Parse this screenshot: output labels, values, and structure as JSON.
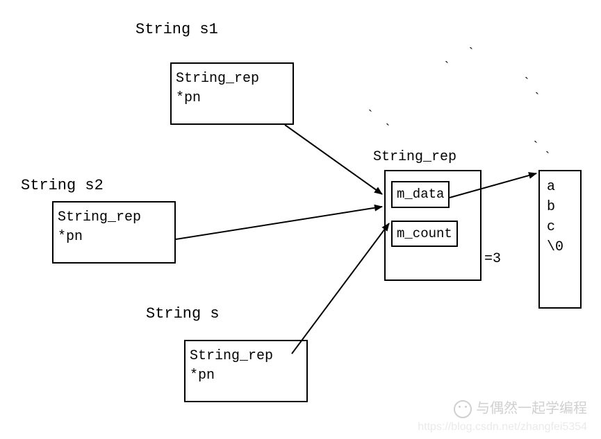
{
  "labels": {
    "s1": "String s1",
    "s2": "String s2",
    "s": "String s"
  },
  "string_box": {
    "line1": "String_rep",
    "line2": "*pn"
  },
  "rep": {
    "title": "String_rep",
    "m_data": "m_data",
    "m_count": "m_count",
    "count_val": "=3"
  },
  "chars": {
    "c0": "a",
    "c1": "b",
    "c2": "c",
    "c3": "\\0"
  },
  "watermark": {
    "text": "与偶然一起学编程",
    "url": "https://blog.csdn.net/zhangfei5354"
  }
}
